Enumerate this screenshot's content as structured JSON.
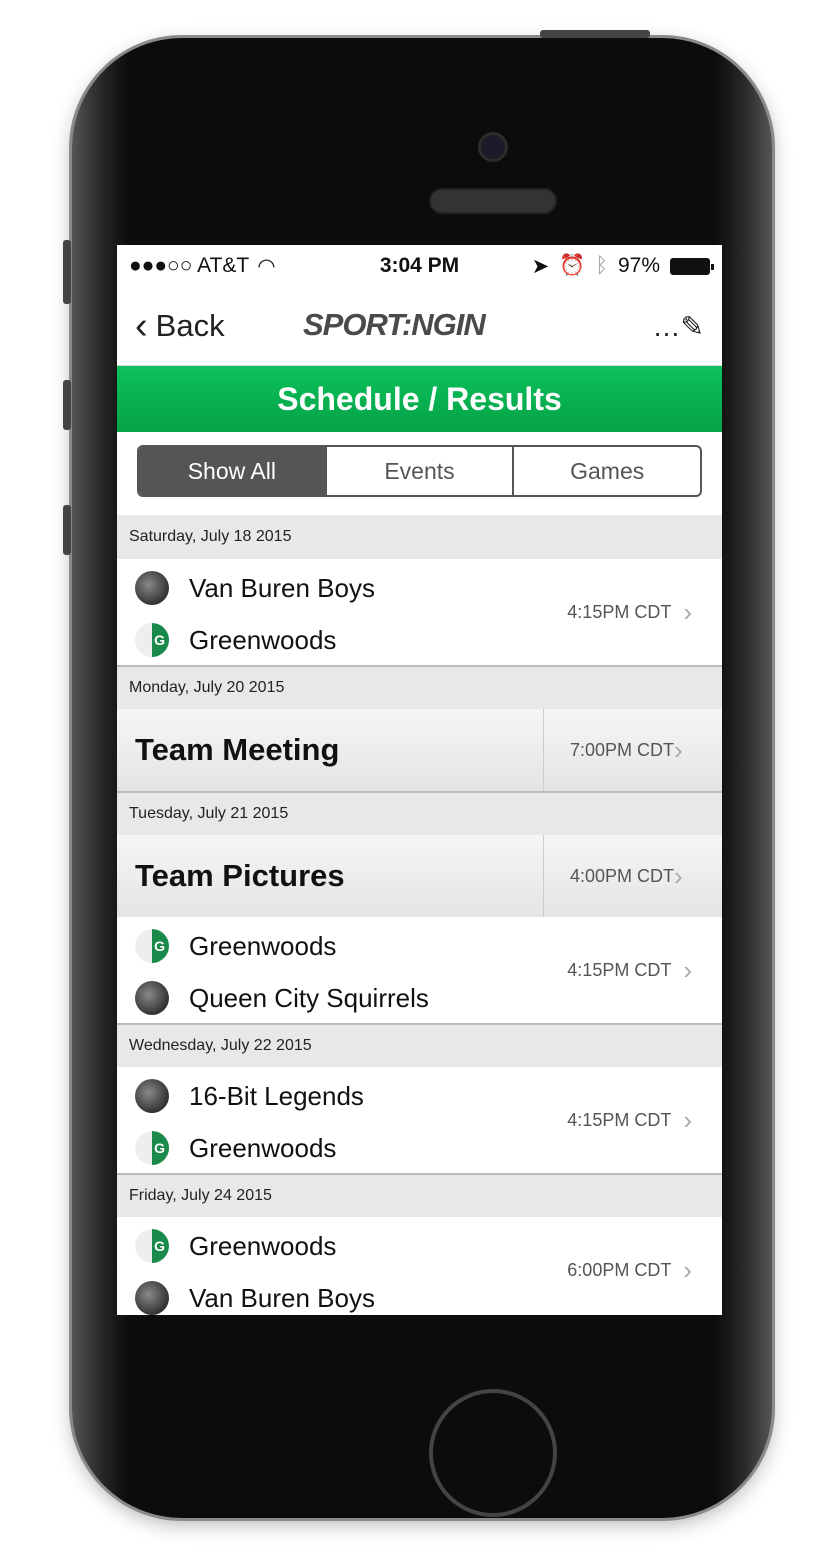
{
  "status": {
    "carrier": "●●●○○ AT&T",
    "time": "3:04 PM",
    "battery": "97%"
  },
  "nav": {
    "back": "Back",
    "logo": "SPORT:NGIN",
    "edit": "…✎"
  },
  "header": {
    "title": "Schedule / Results"
  },
  "segments": [
    "Show All",
    "Events",
    "Games"
  ],
  "schedule": [
    {
      "date": "Saturday, July 18 2015",
      "items": [
        {
          "type": "game",
          "team1": "Van Buren Boys",
          "team1_logo": "ball",
          "team2": "Greenwoods",
          "team2_logo": "gw",
          "time": "4:15PM CDT"
        }
      ]
    },
    {
      "date": "Monday, July 20 2015",
      "items": [
        {
          "type": "event",
          "name": "Team Meeting",
          "time": "7:00PM CDT"
        }
      ]
    },
    {
      "date": "Tuesday, July 21 2015",
      "items": [
        {
          "type": "event",
          "name": "Team Pictures",
          "time": "4:00PM CDT"
        },
        {
          "type": "game",
          "team1": "Greenwoods",
          "team1_logo": "gw",
          "team2": "Queen City Squirrels",
          "team2_logo": "ball",
          "time": "4:15PM CDT"
        }
      ]
    },
    {
      "date": "Wednesday, July 22 2015",
      "items": [
        {
          "type": "game",
          "team1": "16-Bit Legends",
          "team1_logo": "ball",
          "team2": "Greenwoods",
          "team2_logo": "gw",
          "time": "4:15PM CDT"
        }
      ]
    },
    {
      "date": "Friday, July 24 2015",
      "items": [
        {
          "type": "game",
          "team1": "Greenwoods",
          "team1_logo": "gw",
          "team2": "Van Buren Boys",
          "team2_logo": "ball",
          "time": "6:00PM CDT"
        }
      ]
    }
  ],
  "colors": {
    "accent": "#05a246",
    "segment_active": "#555555"
  }
}
